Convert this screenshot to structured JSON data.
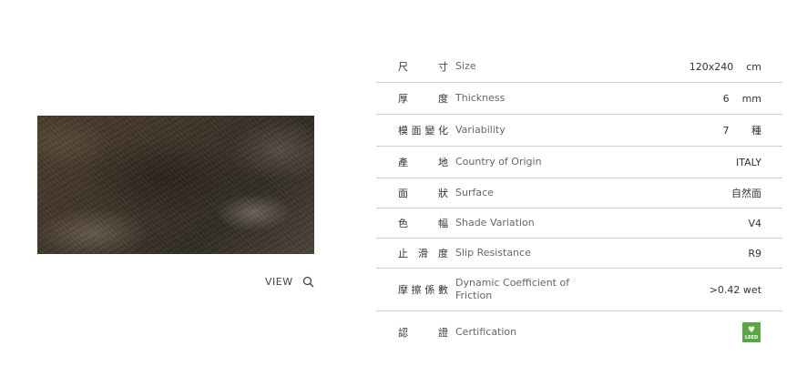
{
  "product": {
    "image_name": "rust-metal-tile-swatch",
    "view_label": "VIEW"
  },
  "specs": [
    {
      "zh": [
        "尺",
        "寸"
      ],
      "en": "Size",
      "value": "120x240    cm"
    },
    {
      "zh": [
        "厚",
        "度"
      ],
      "en": "Thickness",
      "value": "6    mm"
    },
    {
      "zh": [
        "模",
        "面",
        "變",
        "化"
      ],
      "en": "Variability",
      "value": "7       種"
    },
    {
      "zh": [
        "產",
        "地"
      ],
      "en": "Country of Origin",
      "value": "ITALY"
    },
    {
      "zh": [
        "面",
        "狀"
      ],
      "en": "Surface",
      "value": "自然面"
    },
    {
      "zh": [
        "色",
        "幅"
      ],
      "en": "Shade Variation",
      "value": "V4"
    },
    {
      "zh": [
        "止",
        "滑",
        "度"
      ],
      "en": "Slip Resistance",
      "value": "R9"
    },
    {
      "zh": [
        "摩",
        "擦",
        "係",
        "數"
      ],
      "en": "Dynamic Coefficient of Friction",
      "value": ">0.42 wet"
    },
    {
      "zh": [
        "認",
        "證"
      ],
      "en": "Certification",
      "value": "",
      "badge": "LEED"
    }
  ],
  "colors": {
    "divider": "#d0d0d0",
    "leed_green": "#5aa843"
  }
}
